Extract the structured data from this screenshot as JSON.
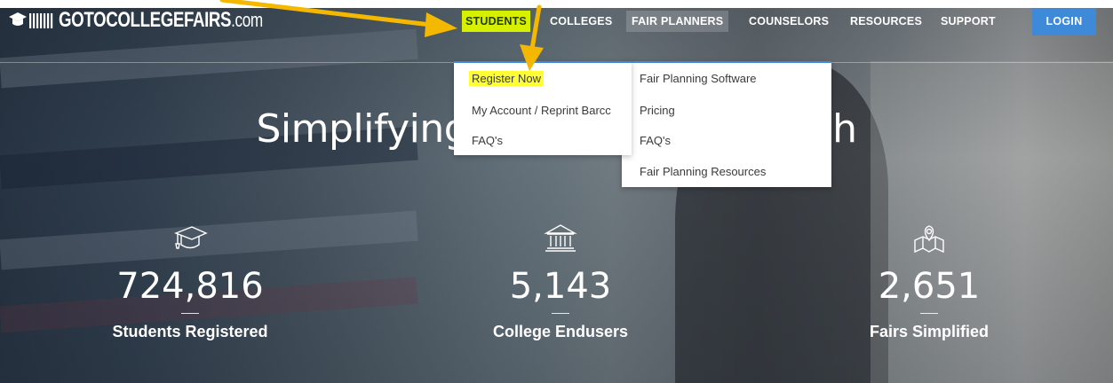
{
  "logo": {
    "name": "GOTOCOLLEGEFAIRS",
    "suffix": ".com"
  },
  "nav": {
    "items": [
      {
        "label": "STUDENTS"
      },
      {
        "label": "COLLEGES"
      },
      {
        "label": "FAIR PLANNERS"
      },
      {
        "label": "COUNSELORS"
      },
      {
        "label": "RESOURCES"
      },
      {
        "label": "SUPPORT"
      }
    ],
    "login_label": "LOGIN"
  },
  "students_menu": {
    "items": [
      "Register Now",
      "My Account / Reprint Barcc",
      "FAQ's"
    ]
  },
  "planners_menu": {
    "items": [
      "Fair Planning Software",
      "Pricing",
      "FAQ's",
      "Fair Planning Resources"
    ]
  },
  "hero": {
    "title_left": "Simplifying Co",
    "title_right": "Finish"
  },
  "stats": [
    {
      "icon": "graduation-cap-icon",
      "value": "724,816",
      "label": "Students Registered"
    },
    {
      "icon": "university-building-icon",
      "value": "5,143",
      "label": "College Endusers"
    },
    {
      "icon": "map-pin-icon",
      "value": "2,651",
      "label": "Fairs Simplified"
    }
  ],
  "colors": {
    "accent": "#d7f000",
    "login": "#3f8ad8",
    "highlight": "#ffff33",
    "arrow": "#f5b800"
  }
}
